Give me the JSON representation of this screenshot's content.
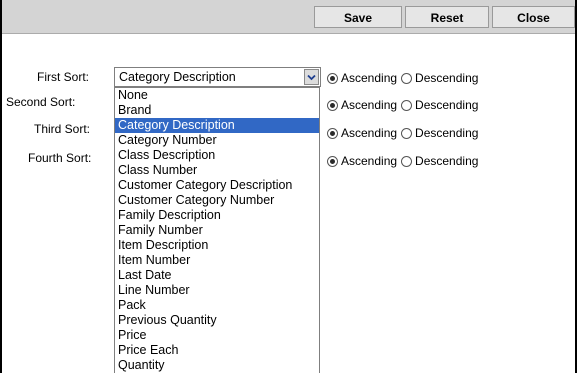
{
  "toolbar": {
    "save_label": "Save",
    "reset_label": "Reset",
    "close_label": "Close"
  },
  "sorts": [
    {
      "label": "First Sort:",
      "order": "Ascending"
    },
    {
      "label": "Second Sort:",
      "order": "Ascending"
    },
    {
      "label": "Third Sort:",
      "order": "Ascending"
    },
    {
      "label": "Fourth Sort:",
      "order": "Ascending"
    }
  ],
  "radio": {
    "ascending_label": "Ascending",
    "descending_label": "Descending"
  },
  "first_sort_select": {
    "value": "Category Description"
  },
  "dropdown": {
    "selected": "Category Description",
    "options": [
      "None",
      "Brand",
      "Category Description",
      "Category Number",
      "Class Description",
      "Class Number",
      "Customer Category Description",
      "Customer Category Number",
      "Family Description",
      "Family Number",
      "Item Description",
      "Item Number",
      "Last Date",
      "Line Number",
      "Pack",
      "Previous Quantity",
      "Price",
      "Price Each",
      "Quantity"
    ]
  },
  "icons": {
    "select_arrow": "chevron-down-icon"
  },
  "colors": {
    "selection": "#3168c5",
    "toolbar": "#d4d4d4"
  }
}
